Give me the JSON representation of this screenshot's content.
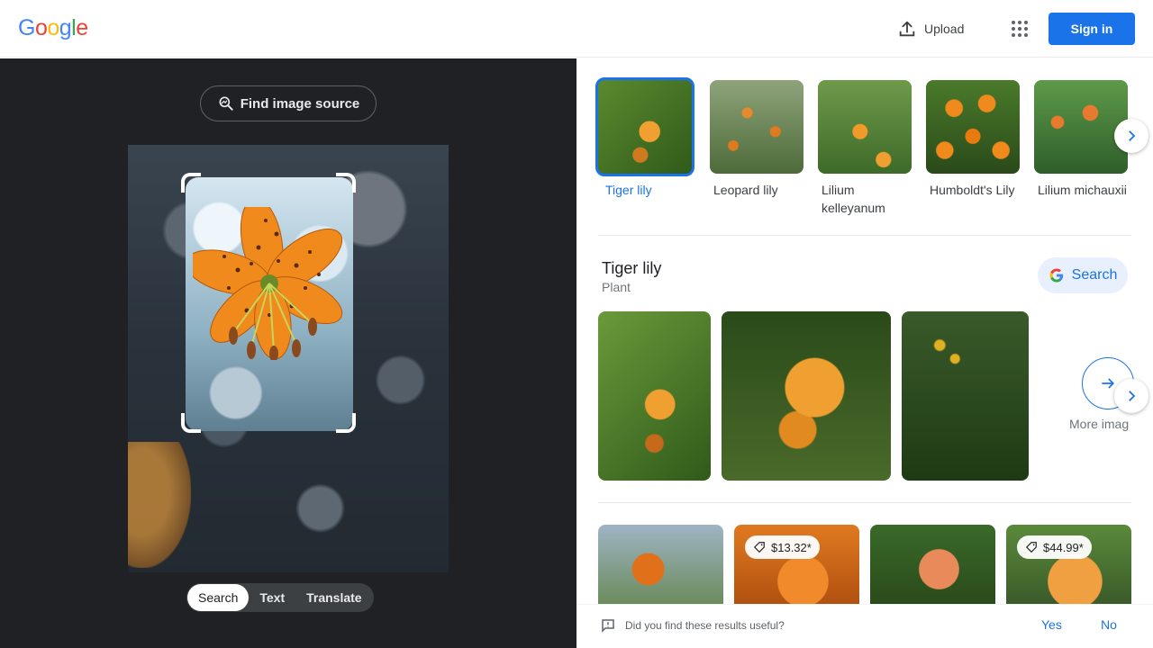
{
  "header": {
    "logo_letters": [
      {
        "ch": "G",
        "color": "#4285F4"
      },
      {
        "ch": "o",
        "color": "#EA4335"
      },
      {
        "ch": "o",
        "color": "#FBBC05"
      },
      {
        "ch": "g",
        "color": "#4285F4"
      },
      {
        "ch": "l",
        "color": "#34A853"
      },
      {
        "ch": "e",
        "color": "#EA4335"
      }
    ],
    "upload_label": "Upload",
    "upload_icon": "upload-icon",
    "apps_icon": "apps-grid-icon",
    "signin_label": "Sign in"
  },
  "left": {
    "find_source_label": "Find image source",
    "modes": [
      {
        "label": "Search",
        "active": true
      },
      {
        "label": "Text",
        "active": false
      },
      {
        "label": "Translate",
        "active": false
      }
    ]
  },
  "chips": [
    {
      "label": "Tiger lily",
      "selected": true
    },
    {
      "label": "Leopard lily",
      "selected": false
    },
    {
      "label": "Lilium kelleyanum",
      "selected": false
    },
    {
      "label": "Humboldt's Lily",
      "selected": false
    },
    {
      "label": "Lilium michauxii",
      "selected": false
    }
  ],
  "entity": {
    "title": "Tiger lily",
    "subtitle": "Plant",
    "search_label": "Search"
  },
  "gallery": {
    "more_label": "More imag"
  },
  "products": [
    {
      "price": ""
    },
    {
      "price": "$13.32*"
    },
    {
      "price": ""
    },
    {
      "price": "$44.99*"
    }
  ],
  "feedback": {
    "question": "Did you find these results useful?",
    "yes": "Yes",
    "no": "No"
  },
  "colors": {
    "accent": "#1a73e8",
    "left_bg": "#202124",
    "lily_orange": "#f08a1c"
  }
}
